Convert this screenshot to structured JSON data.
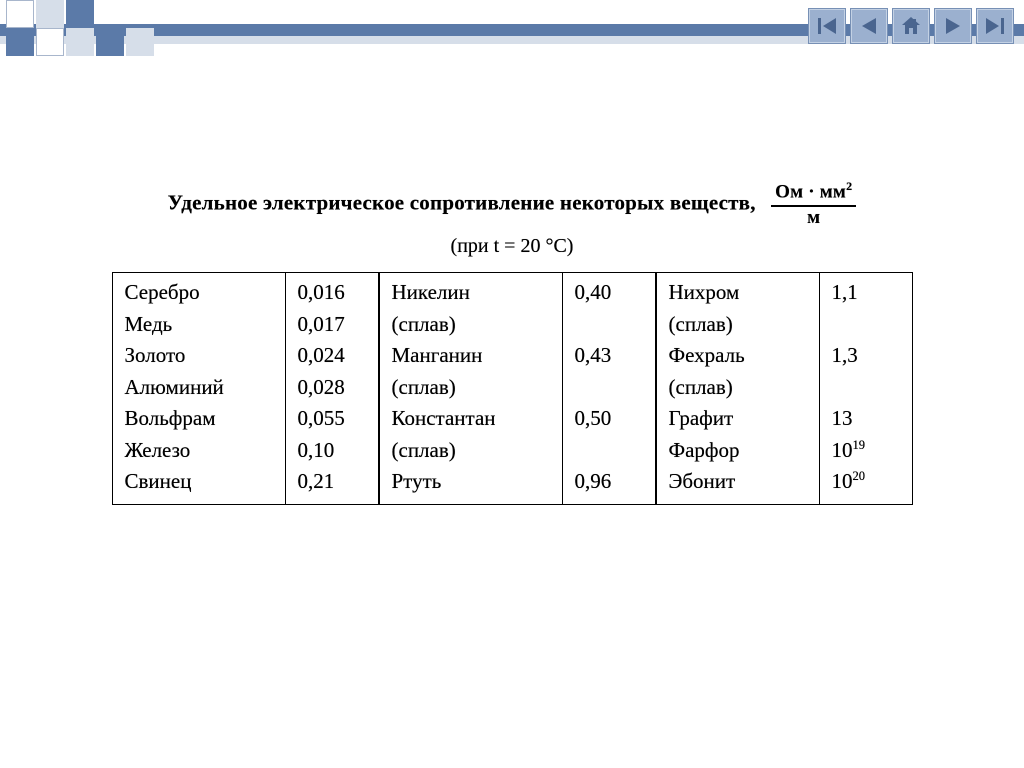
{
  "title_main": "Удельное электрическое сопротивление некоторых веществ,",
  "unit_numerator": "Ом · мм",
  "unit_numerator_sup": "2",
  "unit_denominator": "м",
  "condition": "(при t = 20 °C)",
  "columns": [
    [
      {
        "material": "Серебро",
        "value": "0,016"
      },
      {
        "material": "Медь",
        "value": "0,017"
      },
      {
        "material": "Золото",
        "value": "0,024"
      },
      {
        "material": "Алюминий",
        "value": "0,028"
      },
      {
        "material": "Вольфрам",
        "value": "0,055"
      },
      {
        "material": "Железо",
        "value": "0,10"
      },
      {
        "material": "Свинец",
        "value": "0,21"
      }
    ],
    [
      {
        "material": "Никелин\n(сплав)",
        "value": "0,40"
      },
      {
        "material": "Манганин\n(сплав)",
        "value": "0,43"
      },
      {
        "material": "Константан\n(сплав)",
        "value": "0,50"
      },
      {
        "material": "Ртуть",
        "value": "0,96"
      }
    ],
    [
      {
        "material": "Нихром\n(сплав)",
        "value": "1,1"
      },
      {
        "material": "Фехраль\n(сплав)",
        "value": "1,3"
      },
      {
        "material": "Графит",
        "value": "13"
      },
      {
        "material": "Фарфор",
        "value_base": "10",
        "value_exp": "19"
      },
      {
        "material": "Эбонит",
        "value_base": "10",
        "value_exp": "20"
      }
    ]
  ],
  "nav": {
    "first": "first-slide",
    "prev": "previous-slide",
    "home": "home",
    "next": "next-slide",
    "last": "last-slide"
  }
}
